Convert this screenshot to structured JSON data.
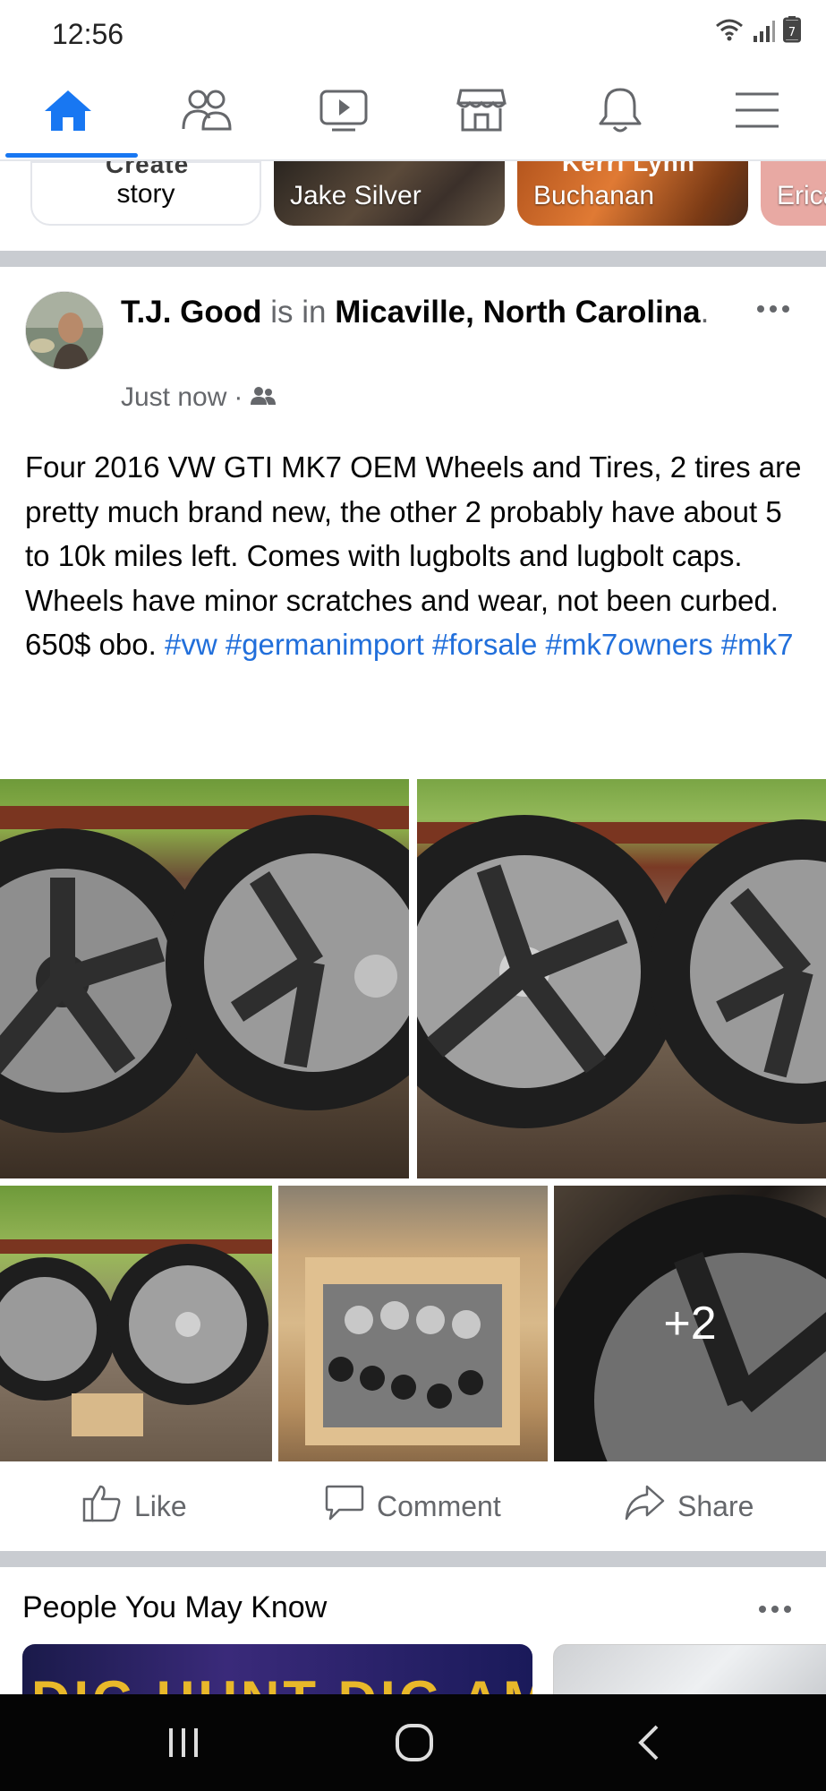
{
  "status_bar": {
    "time": "12:56",
    "icons": [
      "wifi-icon",
      "signal-icon",
      "battery-icon"
    ],
    "battery_level": "7"
  },
  "nav": {
    "items": [
      {
        "name": "home",
        "icon": "home-icon",
        "active": true
      },
      {
        "name": "friends",
        "icon": "friends-icon",
        "active": false
      },
      {
        "name": "watch",
        "icon": "watch-icon",
        "active": false
      },
      {
        "name": "marketplace",
        "icon": "marketplace-icon",
        "active": false
      },
      {
        "name": "notifications",
        "icon": "bell-icon",
        "active": false
      },
      {
        "name": "menu",
        "icon": "menu-icon",
        "active": false
      }
    ],
    "accent_color": "#1877f2"
  },
  "stories": [
    {
      "label": "story",
      "cut_top_label": "Create"
    },
    {
      "label": "Jake Silver"
    },
    {
      "label": "Buchanan",
      "cut_top_label": "Kerri Lynn"
    },
    {
      "label": "Erica"
    }
  ],
  "post": {
    "author": "T.J. Good",
    "is_in": "is in",
    "location": "Micaville, North Carolina",
    "period": ".",
    "time": "Just now",
    "separator": "·",
    "audience_icon": "friends-audience-icon",
    "body_text": "Four 2016 VW GTI MK7 OEM Wheels and Tires, 2 tires are pretty much brand new, the other 2 probably have about 5 to 10k miles left. Comes with lugbolts and lugbolt caps. Wheels have minor scratches and wear, not been curbed. 650$ obo.",
    "hashtags": [
      "#vw",
      "#germanimport",
      "#forsale",
      "#mk7owners",
      "#mk7"
    ],
    "more_photos": "+2"
  },
  "actions": {
    "like": "Like",
    "comment": "Comment",
    "share": "Share"
  },
  "pymk": {
    "title": "People You May Know",
    "card1_text": "DIG HUNT DIG AMOI"
  },
  "colors": {
    "link": "#216fdb",
    "muted": "#65676b",
    "divider": "#c9ccd1"
  }
}
